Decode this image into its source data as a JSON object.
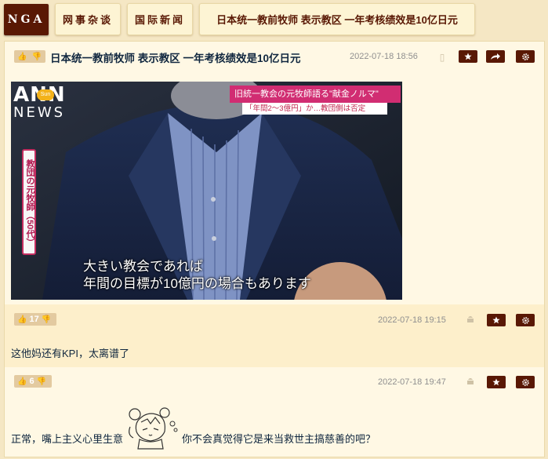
{
  "nav": {
    "logo": "NGA",
    "breadcrumbs": [
      "网事杂谈",
      "国际新闻",
      "日本统一教前牧师 表示教区 一年考核绩效是10亿日元"
    ]
  },
  "colors": {
    "accent": "#591804",
    "background": "#f5e7c4",
    "date": "#8f8f8f"
  },
  "posts": [
    {
      "likes": "",
      "title": "日本统一教前牧师 表示教区 一年考核绩效是10亿日元",
      "date": "2022-07-18 18:56",
      "device_icon": "phone-icon",
      "image": {
        "logo_text": "ANN",
        "sublogo": "NEWS",
        "headline_top": "旧統一教会の元牧師語る\"献金ノルマ\"",
        "headline_bottom": "「年間2〜3億円」か…教団側は否定",
        "side_caption": "教団の元牧師（50代）",
        "subtitle_line1": "大きい教会であれば",
        "subtitle_line2": "年間の目標が10億円の場合もあります"
      }
    },
    {
      "likes": "17",
      "date": "2022-07-18 19:15",
      "device_icon": "android-icon",
      "content": "这他妈还有KPI，太离谱了"
    },
    {
      "likes": "6",
      "date": "2022-07-18 19:47",
      "device_icon": "android-icon",
      "content_before": "正常，嘴上主义心里生意",
      "sticker": "anime-girl-sticker",
      "content_after": "你不会真觉得它是来当救世主搞慈善的吧？"
    }
  ]
}
